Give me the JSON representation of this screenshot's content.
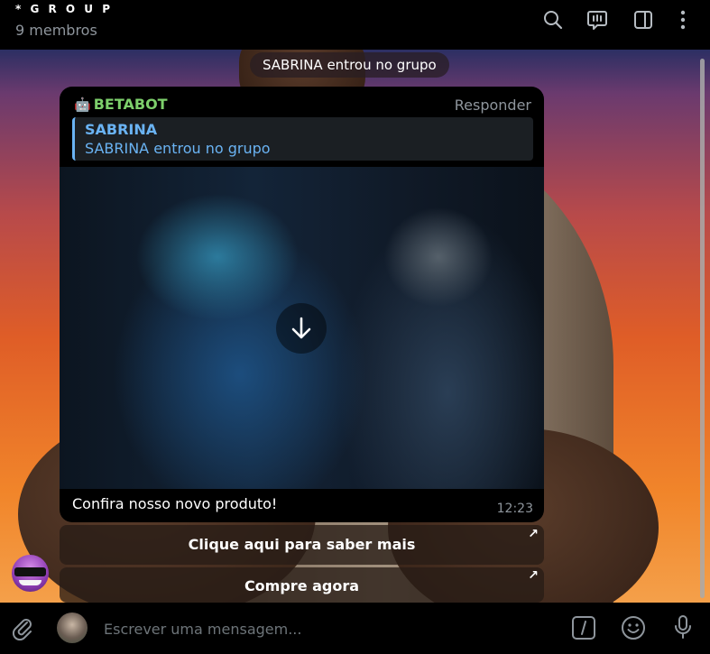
{
  "header": {
    "title": "* G R O U P",
    "members": "9 membros",
    "icons": [
      "search-icon",
      "video-chat-icon",
      "sidebar-toggle-icon",
      "more-vertical-icon"
    ]
  },
  "chat": {
    "service_message": "SABRINA entrou no grupo",
    "message": {
      "sender_icon": "🤖",
      "sender": "BETABOT",
      "reply_label": "Responder",
      "quote_name": "SABRINA",
      "quote_text": "SABRINA entrou no grupo",
      "media_icon": "download-arrow-icon",
      "caption": "Confira nosso novo produto!",
      "time": "12:23"
    },
    "buttons": [
      {
        "label": "Clique aqui para saber mais",
        "arrow": "↗"
      },
      {
        "label": "Compre agora",
        "arrow": "↗"
      }
    ]
  },
  "composer": {
    "placeholder": "Escrever uma mensagem...",
    "icons": [
      "attach-icon",
      "avatar",
      "bot-commands-icon",
      "emoji-icon",
      "microphone-icon"
    ]
  },
  "colors": {
    "header_bg": "#000000",
    "accent_blue": "#6ab3f3",
    "sender_green": "#7dcf6b",
    "muted_text": "#8e959c"
  }
}
